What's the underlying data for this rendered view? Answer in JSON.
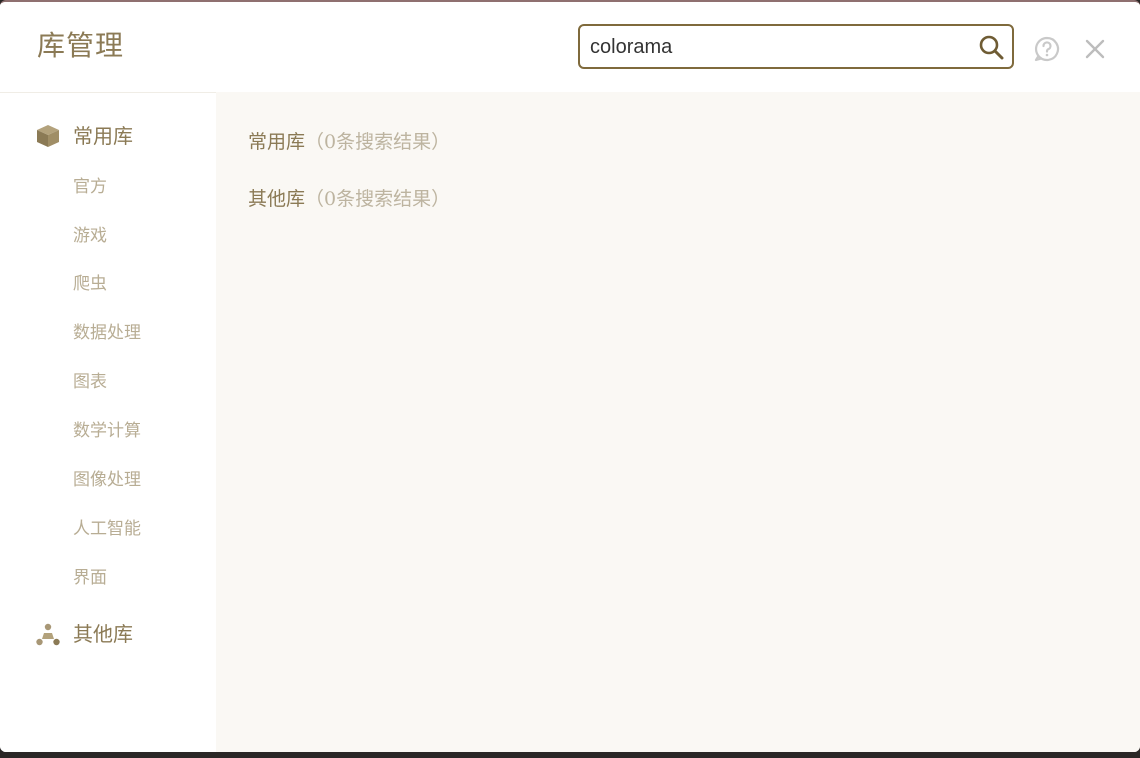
{
  "header": {
    "title": "库管理",
    "search": {
      "value": "colorama",
      "placeholder": ""
    }
  },
  "sidebar": {
    "categories": [
      {
        "label": "常用库",
        "icon": "cube-icon",
        "items": [
          "官方",
          "游戏",
          "爬虫",
          "数据处理",
          "图表",
          "数学计算",
          "图像处理",
          "人工智能",
          "界面"
        ]
      },
      {
        "label": "其他库",
        "icon": "molecule-icon",
        "items": []
      }
    ]
  },
  "main": {
    "results": [
      {
        "name": "常用库",
        "count_text": "（0条搜索结果）"
      },
      {
        "name": "其他库",
        "count_text": "（0条搜索结果）"
      }
    ]
  },
  "colors": {
    "accent": "#8b7a55",
    "search_border": "#7f6a3c",
    "muted_text": "#b8ad94",
    "content_bg": "#faf8f4"
  }
}
